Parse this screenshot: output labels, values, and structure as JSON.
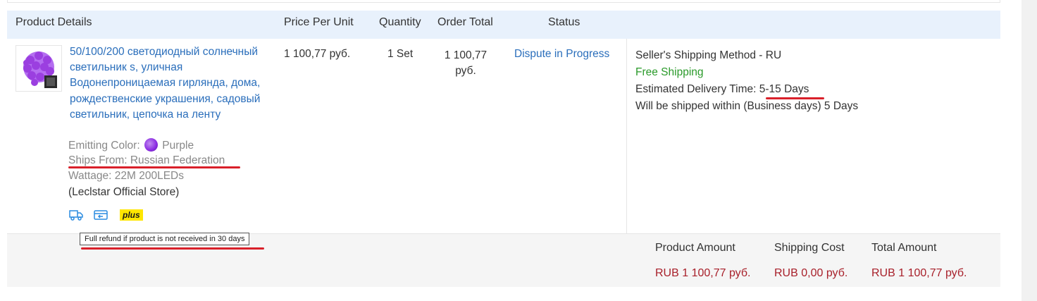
{
  "header": {
    "product_details": "Product Details",
    "price_per_unit": "Price Per Unit",
    "quantity": "Quantity",
    "order_total": "Order Total",
    "status": "Status"
  },
  "product": {
    "title": "50/100/200 светодиодный солнечный светильник s, уличная Водонепроницаемая гирлянда, дома, рождественские украшения, садовый светильник, цепочка на ленту",
    "emitting_color_label": "Emitting Color:",
    "emitting_color_value": "Purple",
    "ships_from": "Ships From: Russian Federation",
    "wattage": "Wattage: 22M 200LEDs",
    "store": "(Leclstar Official Store)",
    "badge_plus": "plus",
    "icons": [
      "delivery-truck-icon",
      "card-return-icon"
    ],
    "swatch_color": "#8a2be2"
  },
  "order": {
    "price": "1 100,77 руб.",
    "quantity": "1 Set",
    "order_total_line1": "1 100,77",
    "order_total_line2": "руб.",
    "status": "Dispute in Progress"
  },
  "shipping": {
    "method": "Seller's Shipping Method - RU",
    "free": "Free Shipping",
    "delivery_label": "Estimated Delivery Time:",
    "delivery_value": "5-15 Days",
    "ship_within": "Will be shipped within (Business days) 5 Days"
  },
  "summary": {
    "product_amount_label": "Product Amount",
    "shipping_cost_label": "Shipping Cost",
    "total_amount_label": "Total Amount",
    "product_amount": "RUB 1 100,77 руб.",
    "shipping_cost": "RUB 0,00 руб.",
    "total_amount": "RUB 1 100,77 руб."
  },
  "tooltip": "Full refund if product is not received in 30 days",
  "colors": {
    "link": "#2a6ebb",
    "free": "#2a9a2a",
    "price_red": "#a8202a",
    "header_bg": "#e8f1fc",
    "annotation_red": "#d9202a"
  }
}
